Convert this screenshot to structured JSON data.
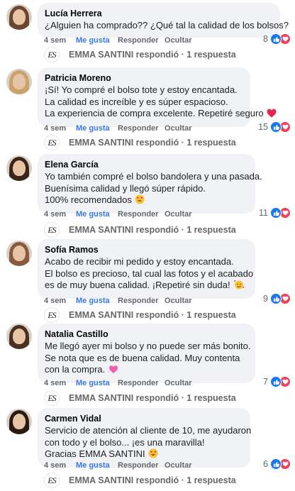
{
  "labels": {
    "like": "Me gusta",
    "reply": "Responder",
    "hide": "Ocultar",
    "page_reply": "EMMA SANTINI respondió · 1 respuesta",
    "logo_text": "ES"
  },
  "comments": [
    {
      "name": "Lucía Herrera",
      "lines": [
        "¿Alguien ha comprado?? ¿Qué tal la calidad de los bolsos?"
      ],
      "time": "4 sem",
      "reactions": "8",
      "hair": "#6b4630"
    },
    {
      "name": "Patricia Moreno",
      "lines": [
        "¡Sí! Yo compré el bolso tote y estoy encantada.",
        "La calidad es increíble y es súper espacioso.",
        "La experiencia de compra excelente. Repetiré seguro"
      ],
      "emoji": "heart",
      "time": "4 sem",
      "reactions": "15",
      "hair": "#c9a36b"
    },
    {
      "name": "Elena García",
      "lines": [
        "Yo también compré el bolso bandolera y una pasada.",
        "Buenísima calidad y llegó súper rápido.",
        "100% recomendados"
      ],
      "emoji": "heart-eyes",
      "time": "4 sem",
      "reactions": "11",
      "hair": "#3b2418"
    },
    {
      "name": "Sofía Ramos",
      "lines": [
        "Acabo de recibir mi pedido y estoy encantada.",
        "El bolso es precioso, tal cual las fotos y el acabado",
        "es de muy buena calidad. ¡Repetiré sin duda!"
      ],
      "emoji": "hearts-face",
      "time": "4 sem",
      "reactions": "9",
      "hair": "#8a5a3c"
    },
    {
      "name": "Natalia Castillo",
      "lines": [
        "Me llegó ayer mi bolso y no puede ser más bonito.",
        "Se nota que es de buena calidad. Muy contenta",
        "con la compra."
      ],
      "emoji": "sparkling-heart",
      "time": "4 sem",
      "reactions": "7",
      "hair": "#4a3020"
    },
    {
      "name": "Carmen Vidal",
      "lines": [
        "Servicio de atención al cliente de 10, me ayudaron",
        "con todo y el bolso... ¡es una maravilla!",
        "Gracias EMMA SANTINI"
      ],
      "emoji": "heart-eyes",
      "time": "4 sem",
      "reactions": "6",
      "hair": "#2a1a12"
    }
  ]
}
